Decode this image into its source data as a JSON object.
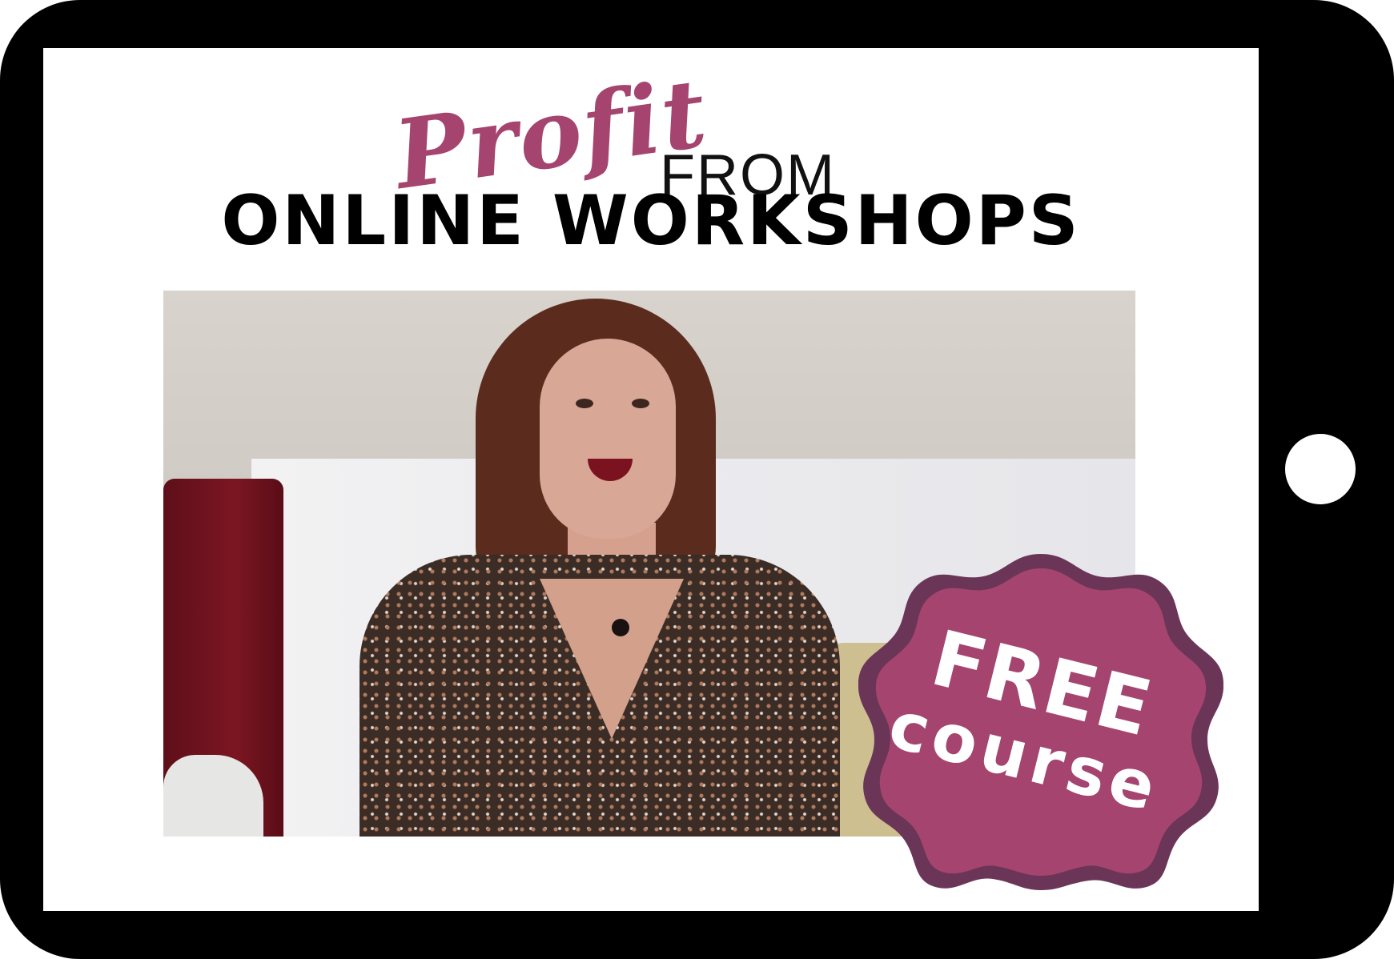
{
  "title": {
    "script_word": "Profit",
    "from_word": "FROM",
    "main_line": "ONLINE WORKSHOPS"
  },
  "badge": {
    "line1": "FREE",
    "line2": "course"
  },
  "colors": {
    "accent": "#a5446f",
    "badge_fill": "#a5446f",
    "badge_border": "#6b3558",
    "tablet_frame": "#000000"
  }
}
